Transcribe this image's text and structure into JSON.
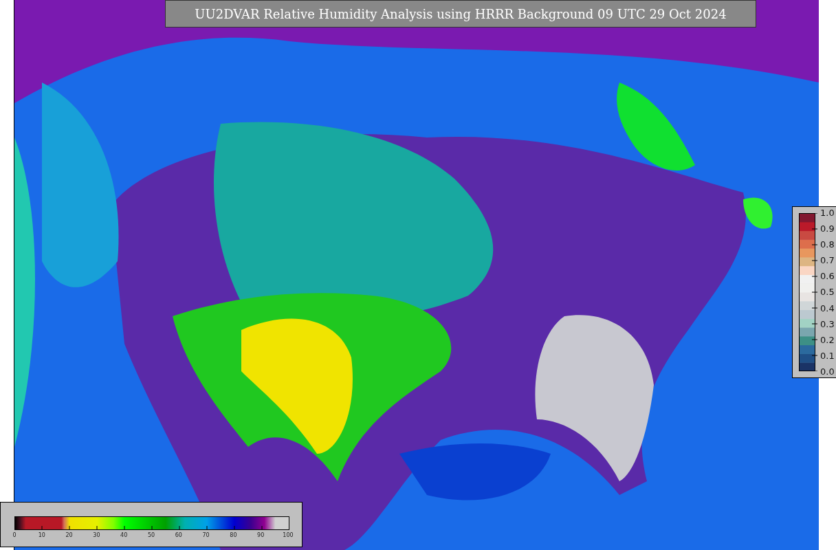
{
  "title": "UU2DVAR Relative Humidity Analysis using HRRR Background 09 UTC 29 Oct 2024",
  "right_colorbar": {
    "ticks": [
      "1.0",
      "0.9",
      "0.8",
      "0.7",
      "0.6",
      "0.5",
      "0.4",
      "0.3",
      "0.2",
      "0.1",
      "0.0"
    ]
  },
  "bottom_colorbar": {
    "ticks": [
      "0",
      "10",
      "20",
      "30",
      "40",
      "50",
      "60",
      "70",
      "80",
      "90",
      "100"
    ]
  }
}
